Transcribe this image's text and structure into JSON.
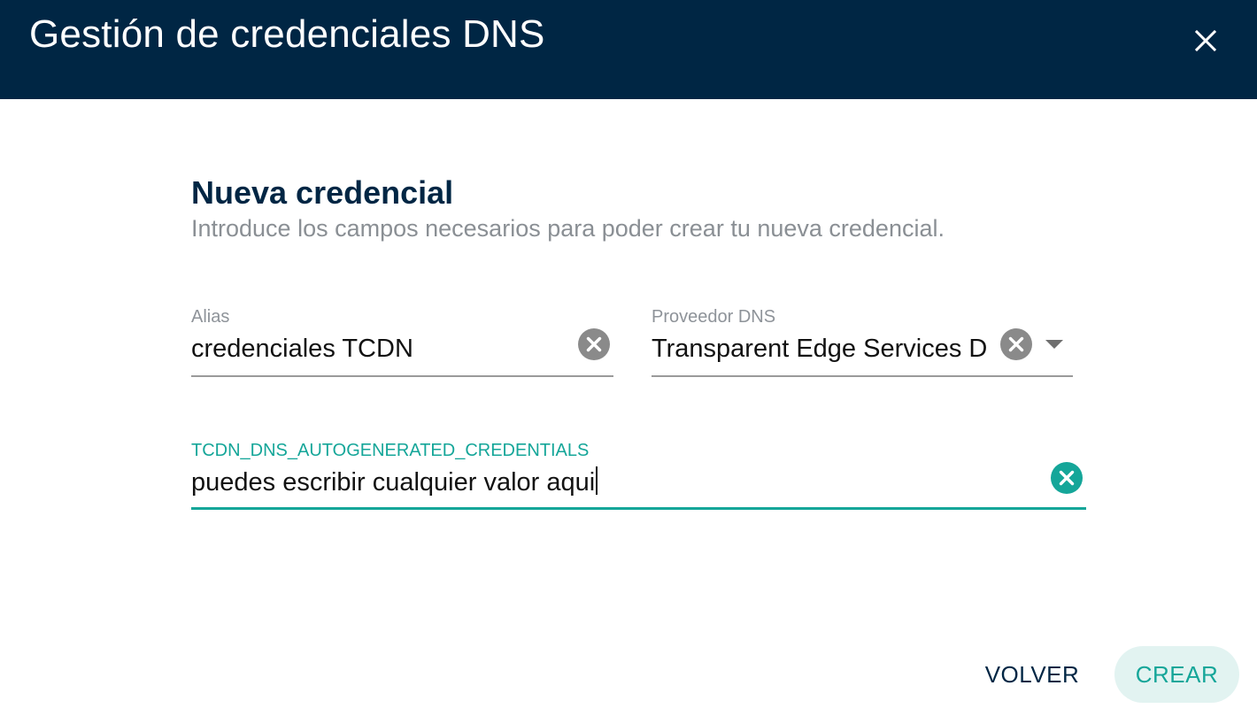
{
  "dialog": {
    "title": "Gestión de credenciales DNS"
  },
  "section": {
    "title": "Nueva credencial",
    "subtitle": "Introduce los campos necesarios para poder crear tu nueva credencial."
  },
  "fields": {
    "alias": {
      "label": "Alias",
      "value": "credenciales TCDN"
    },
    "provider": {
      "label": "Proveedor DNS",
      "value": "Transparent Edge Services D"
    },
    "credentials": {
      "label": "TCDN_DNS_AUTOGENERATED_CREDENTIALS",
      "value": "puedes escribir cualquier valor aqui"
    }
  },
  "actions": {
    "back_label": "VOLVER",
    "create_label": "CREAR"
  },
  "colors": {
    "header_bg": "#002644",
    "accent": "#15a699",
    "accent_bg": "#e2f3f1",
    "clear_icon_gray": "#8a8a8a"
  },
  "icons": {
    "close": "close-icon",
    "clear": "clear-circle-icon",
    "dropdown": "dropdown-arrow-icon"
  }
}
